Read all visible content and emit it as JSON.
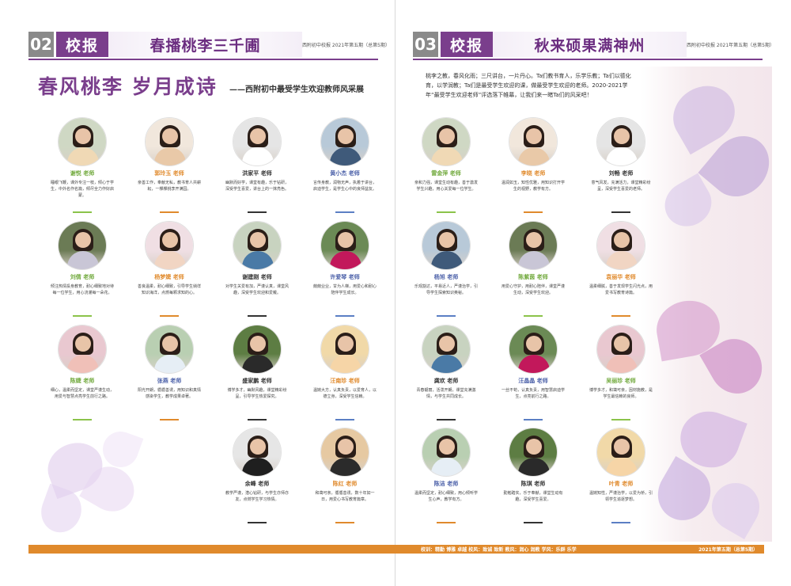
{
  "left_page": {
    "page_number": "02",
    "logo_text": "校报",
    "header_title": "春播桃李三千圃",
    "header_meta": "西附初中校报  2021年第五期（总第5期）",
    "main_title": "春风桃李  岁月成诗",
    "subtitle": "——西附初中最受学生欢迎教师风采展",
    "teachers": [
      {
        "name": "谢悦 老师",
        "desc": "睡眼飞鞭，课外专注一枝，倾心于学生，中外名作名篇，倾尽全力作好启蒙。"
      },
      {
        "name": "郭玲玉 老师",
        "desc": "亲善工作，奉献无私，教书育人共耕耘，一棵棵桃李开满园。"
      },
      {
        "name": "洪家平 老师",
        "desc": "幽默而好学，课堂有趣，乐于钻研，深受学生喜爱，讲台上的一抹亮色。"
      },
      {
        "name": "黄小杰 老师",
        "desc": "言传身教，润物无声，执着于讲台，启迪学生，是学生心中的良师益友。"
      },
      {
        "name": "刘倩 老师",
        "desc": "倾注热情投身教育，耐心细致地对待每一位学生，用心浇灌每一朵花。"
      },
      {
        "name": "杨梦婕 老师",
        "desc": "善良温柔，耐心细致，引导学生徜徉知识海洋，点燃每颗求知的心。"
      },
      {
        "name": "谢建刚 老师",
        "desc": "对学生关爱有加，严谨认真，课堂风趣，深受学生欢迎和爱戴。"
      },
      {
        "name": "许爱琴 老师",
        "desc": "兢兢业业，甘为人梯，用爱心和耐心陪伴学生成长。"
      },
      {
        "name": "陈婕 老师",
        "desc": "细心，温柔而坚定，课堂严谨生动，用爱与智慧点亮学生前行之路。"
      },
      {
        "name": "张燕 老师",
        "desc": "阳光开朗，循循善诱，用知识和真情感染学生，教学成果卓著。"
      },
      {
        "name": "盛家鹏 老师",
        "desc": "博学多才，幽默风趣，课堂精彩纷呈，引导学生热爱探究。"
      },
      {
        "name": "汪南珍 老师",
        "desc": "温婉大方，认真负责，以爱育人，以德立身，深受学生信赖。"
      },
      {
        "name": "余峰 老师",
        "desc": "教学严谨，潜心钻研，与学生亦师亦友，点燃学生学习热情。"
      },
      {
        "name": "陈红 老师",
        "desc": "和蔼可亲，循循善诱，数十年如一日，用爱心书写教育篇章。"
      }
    ]
  },
  "right_page": {
    "page_number": "03",
    "logo_text": "校报",
    "header_title": "秋来硕果满神州",
    "header_meta": "西附初中校报  2021年第五期（总第5期）",
    "intro": "桃李之教，春风化雨；三尺讲台，一片丹心。Ta们教书育人，乐学乐教；Ta们以德化育，以学润教；Ta们是最受学生欢迎的课，做最受学生欢迎的老师。2020-2021学年“最受学生欢迎老师”评选落下帷幕，让我们来一睹Ta们的风采吧！",
    "teachers": [
      {
        "name": "雷金萍 老师",
        "desc": "亲和力强，课堂生动有趣，善于激发学生兴趣，用心关爱每一位学生。"
      },
      {
        "name": "李晓 老师",
        "desc": "温润如玉，知性优雅，用知识打开学生的视野，教学有方。"
      },
      {
        "name": "刘畅 老师",
        "desc": "意气风发，充满活力，课堂精彩纷呈，深受学生喜爱的老师。"
      },
      {
        "name": "杨旭 老师",
        "desc": "乐观豁达，平易近人，严谨治学，引导学生探索知识奥秘。"
      },
      {
        "name": "陈紫茵 老师",
        "desc": "用爱心守护，用耐心陪伴，课堂严谨生动，深受学生欢迎。"
      },
      {
        "name": "袁丽华 老师",
        "desc": "温柔细腻，善于发现学生闪光点，用爱书写教育诗篇。"
      },
      {
        "name": "龚欢 老师",
        "desc": "青春靓丽，活泼开朗，课堂充满激情，与学生共同成长。"
      },
      {
        "name": "汪晶晶 老师",
        "desc": "一丝不苟，认真负责，用智慧启迪学生，点亮前行之路。"
      },
      {
        "name": "吴丽珍 老师",
        "desc": "博学多才，和蔼可亲，因材施教，是学生最信赖的良师。"
      },
      {
        "name": "陈洁 老师",
        "desc": "温柔而坚定，耐心细致，用心倾听学生心声，教学有方。"
      },
      {
        "name": "陈琪 老师",
        "desc": "勤勉踏实，乐于奉献，课堂生动有趣，深受学生喜爱。"
      },
      {
        "name": "叶青 老师",
        "desc": "温婉知性，严谨治学，以爱为桥，引领学生追逐梦想。"
      }
    ]
  },
  "footer": {
    "motto": "校训：精勤  博雅  卓越    校风：致诚 致新    教风：润心 润教    学风：乐群 乐学",
    "issue": "2021年第五期（总第5期）"
  },
  "colors": {
    "accent_purple": "#7a3e8c",
    "footer_orange": "#e08a2c",
    "page_num_gray": "#8a8a8a"
  }
}
